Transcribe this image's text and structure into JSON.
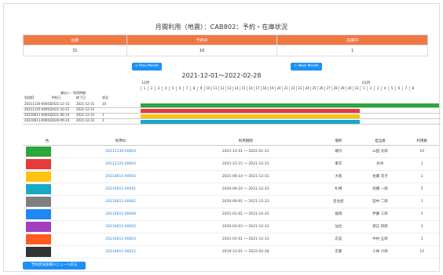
{
  "page": {
    "title": "月間利用（地震）：CAB802：予約・在庫状況"
  },
  "summary": {
    "headers": [
      "台数",
      "予約中",
      "在庫中"
    ],
    "values": [
      "31",
      "16",
      "1"
    ]
  },
  "nav": {
    "prev_label": "< Prev Month",
    "next_label": "> Next Month",
    "range": "2021-12-01～2022-02-28"
  },
  "gantt": {
    "months": [
      "12月",
      "01月"
    ],
    "group_header": "貸出人／利用時間",
    "days_dec": [
      "1",
      "2",
      "3",
      "4",
      "5",
      "6",
      "7",
      "8",
      "9",
      "10",
      "11",
      "12",
      "13",
      "14",
      "15",
      "16",
      "17",
      "18",
      "19",
      "20",
      "21",
      "22",
      "23",
      "24",
      "25",
      "26",
      "27",
      "28",
      "29",
      "30",
      "31"
    ],
    "days_jan": [
      "1",
      "2",
      "3",
      "4",
      "5",
      "6",
      "7",
      "8"
    ],
    "col_headers": [
      "利用ID",
      "予約日",
      "終了日",
      "状況"
    ],
    "rows": [
      [
        "20211130-00003",
        "2021-12-15",
        "2021-12-31",
        "10"
      ],
      [
        "20211125-00001",
        "2021-10-15",
        "2021-12-31",
        ""
      ],
      [
        "20210611-00003",
        "2021-06-14",
        "2021-12-31",
        "1"
      ],
      [
        "20210611-00001",
        "2020-09-24",
        "2021-12-31",
        "1"
      ]
    ],
    "colors": [
      "#2ca63d",
      "#e63b3b",
      "#ffc20e",
      "#1aa9c4"
    ]
  },
  "list": {
    "headers": [
      "色",
      "利用ID",
      "利用期間",
      "場所",
      "担当者",
      "利用数"
    ],
    "rows": [
      {
        "color": "#2ca63d",
        "id": "20211130-00003",
        "period": "2021-12-01 ～ 2022-01-31",
        "place": "横浜",
        "person": "山田 太郎",
        "count": "10"
      },
      {
        "color": "#e63b3b",
        "id": "20211125-00003",
        "period": "2021-12-15 ～ 2021-12-31",
        "place": "東京",
        "person": "鈴木",
        "count": "1"
      },
      {
        "color": "#ffc20e",
        "id": "20210611-00003",
        "period": "2021-06-14 ～ 2021-12-31",
        "place": "大阪",
        "person": "佐藤 花子",
        "count": "1"
      },
      {
        "color": "#1aa9c4",
        "id": "20210611-00001",
        "period": "2020-09-24 ～ 2021-12-31",
        "place": "札幌",
        "person": "高橋 一郎",
        "count": "5"
      },
      {
        "color": "#7f7f7f",
        "id": "20210611-00001",
        "period": "2020-09-01 ～ 2021-12-31",
        "place": "名古屋",
        "person": "田中 二郎",
        "count": "1"
      },
      {
        "color": "#1e88f5",
        "id": "20210611-00004",
        "period": "2021-01-01 ～ 2021-12-31",
        "place": "福岡",
        "person": "伊藤 三郎",
        "count": "1"
      },
      {
        "color": "#a13fbf",
        "id": "20210611-00002",
        "period": "2020-03-03 ～ 2021-12-31",
        "place": "仙台",
        "person": "渡辺 四郎",
        "count": "3"
      },
      {
        "color": "#ff5a1f",
        "id": "20210611-00003",
        "period": "2021-01-01 ～ 2021-12-31",
        "place": "広島",
        "person": "中村 五郎",
        "count": "1"
      },
      {
        "color": "#333333",
        "id": "20210611-00012",
        "period": "2019-12-01 ～ 2022-02-28",
        "place": "京都",
        "person": "小林 六郎",
        "count": "15"
      }
    ]
  },
  "footer": {
    "back_label": "予約状況詳細メニューへ戻る"
  }
}
